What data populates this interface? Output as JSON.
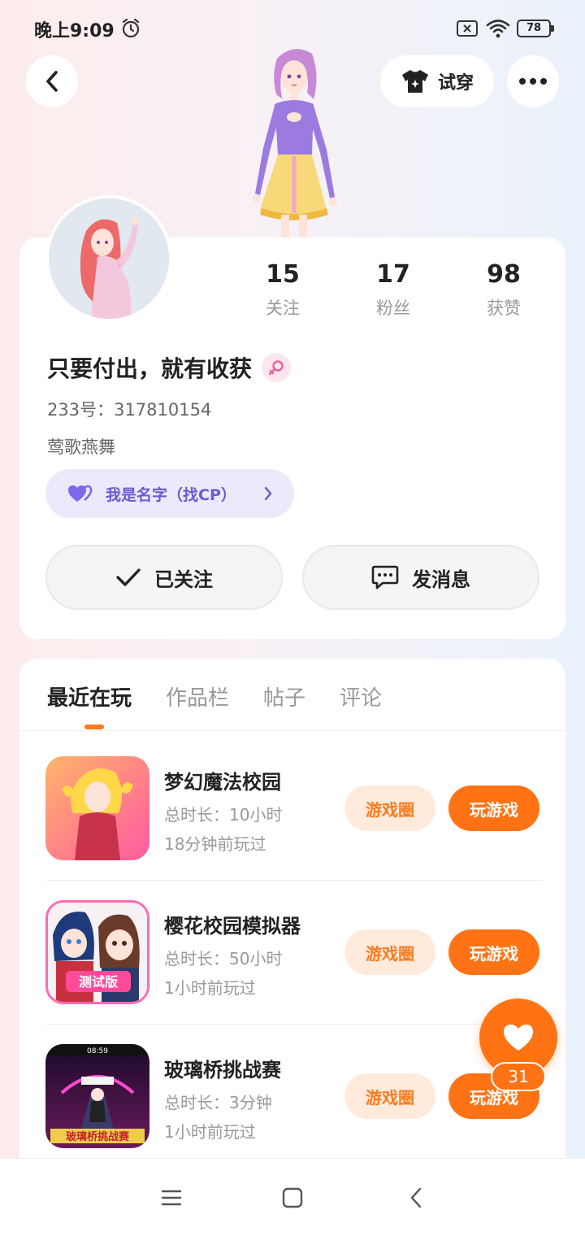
{
  "status_bar": {
    "time": "晚上9:09",
    "battery": "78"
  },
  "header": {
    "tryon_label": "试穿"
  },
  "profile": {
    "stats": [
      {
        "value": "15",
        "label": "关注"
      },
      {
        "value": "17",
        "label": "粉丝"
      },
      {
        "value": "98",
        "label": "获赞"
      }
    ],
    "nickname": "只要付出，就有收获",
    "user_id": "233号：317810154",
    "signature": "莺歌燕舞",
    "cp_label": "我是名字（找CP）",
    "follow_label": "已关注",
    "message_label": "发消息"
  },
  "tabs": [
    "最近在玩",
    "作品栏",
    "帖子",
    "评论"
  ],
  "games": [
    {
      "name": "梦幻魔法校园",
      "duration": "总时长：10小时",
      "last_played": "18分钟前玩过",
      "circle_label": "游戏圈",
      "play_label": "玩游戏"
    },
    {
      "name": "樱花校园模拟器",
      "duration": "总时长：50小时",
      "last_played": "1小时前玩过",
      "circle_label": "游戏圈",
      "play_label": "玩游戏",
      "icon_text": "测试版"
    },
    {
      "name": "玻璃桥挑战赛",
      "duration": "总时长：3分钟",
      "last_played": "1小时前玩过",
      "circle_label": "游戏圈",
      "play_label": "玩游戏",
      "icon_text": "玻璃桥挑战赛",
      "icon_hud_left": "08:59"
    }
  ],
  "like_count": "31",
  "colors": {
    "accent": "#ff7314",
    "accent_light": "#ffeadc",
    "cp_purple": "#6a5ad6"
  }
}
